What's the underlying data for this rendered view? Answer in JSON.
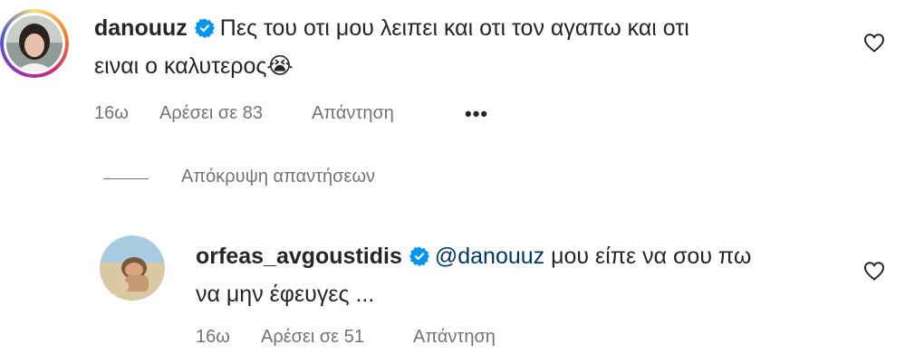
{
  "comments": [
    {
      "username": "danouuz",
      "text_line1": "Πες του οτι μου λειπει και οτι τον αγαπω και οτι",
      "text_line2": "ειναι ο καλυτερος",
      "emoji": "😭",
      "time": "16ω",
      "likes_label": "Αρέσει σε 83",
      "reply_label": "Απάντηση",
      "more_label": "•••"
    }
  ],
  "hide_replies_label": "Απόκρυψη απαντήσεων",
  "replies": [
    {
      "username": "orfeas_avgoustidis",
      "mention": "@danouuz",
      "text_line1": " μου είπε να σου πω",
      "text_line2": "να μην έφευγες ...",
      "time": "16ω",
      "likes_label": "Αρέσει σε 51",
      "reply_label": "Απάντηση"
    }
  ],
  "colors": {
    "text": "#262626",
    "secondary": "#737373",
    "mention": "#00376b",
    "verified": "#0095f6"
  },
  "icons": {
    "verified": "verified-badge-icon",
    "like": "heart-outline-icon"
  }
}
